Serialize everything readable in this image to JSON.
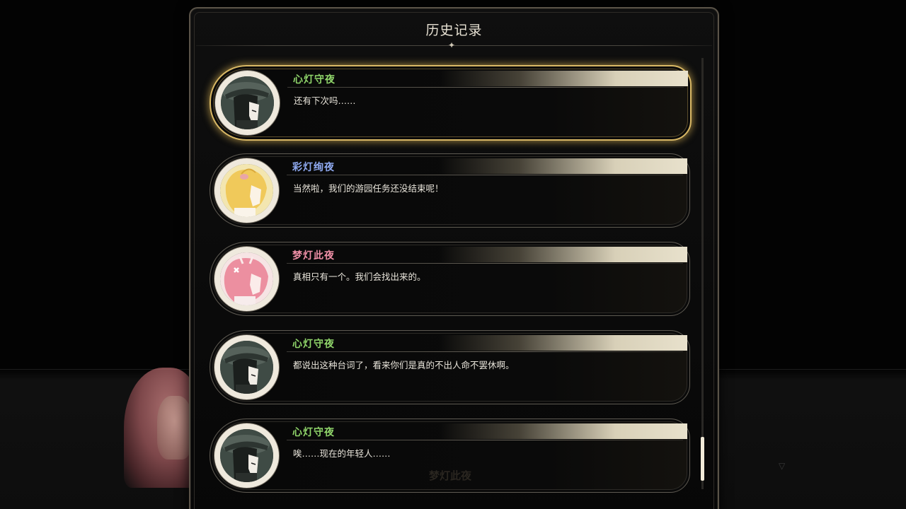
{
  "history": {
    "title": "历史记录",
    "entries": [
      {
        "speaker": "心灯守夜",
        "line": "还有下次吗……",
        "name_color": "#8fd46a",
        "portrait": "dark-hair-character-icon",
        "selected": true
      },
      {
        "speaker": "彩灯绚夜",
        "line": "当然啦，我们的游园任务还没结束呢！",
        "name_color": "#8ea8ee",
        "portrait": "blonde-character-icon",
        "selected": false
      },
      {
        "speaker": "梦灯此夜",
        "line": "真相只有一个。我们会找出来的。",
        "name_color": "#ee8fa6",
        "portrait": "pink-hair-character-icon",
        "selected": false
      },
      {
        "speaker": "心灯守夜",
        "line": "都说出这种台词了，看来你们是真的不出人命不罢休啊。",
        "name_color": "#8fd46a",
        "portrait": "dark-hair-character-icon",
        "selected": false
      },
      {
        "speaker": "心灯守夜",
        "line": "唉……现在的年轻人……",
        "name_color": "#8fd46a",
        "portrait": "dark-hair-character-icon",
        "selected": false
      }
    ]
  },
  "background": {
    "speaker_name": "梦灯此夜"
  },
  "scrollbar": {
    "position": 0.92
  }
}
